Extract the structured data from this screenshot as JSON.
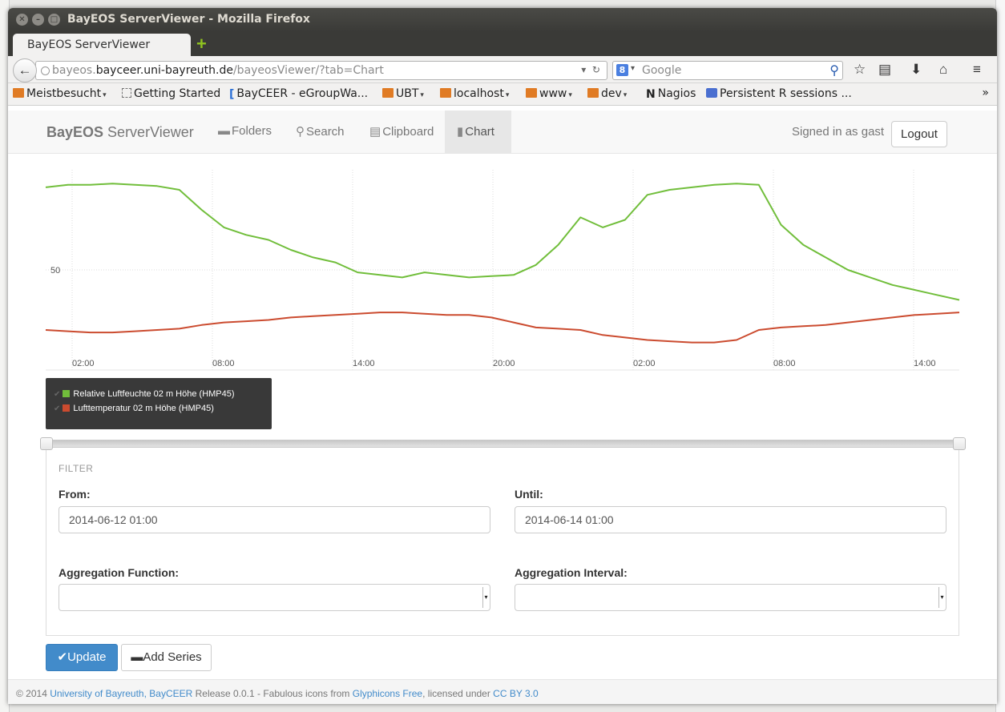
{
  "window": {
    "title": "BayEOS ServerViewer - Mozilla Firefox"
  },
  "browser": {
    "tab_title": "BayEOS ServerViewer",
    "url_prefix": "bayeos.",
    "url_domain": "bayceer.uni-bayreuth.de",
    "url_path": "/bayeosViewer/?tab=Chart",
    "search_placeholder": "Google",
    "bookmarks": [
      {
        "label": "Meistbesucht",
        "icon": "folder-icon",
        "caret": "▾"
      },
      {
        "label": "Getting Started",
        "icon": "blank-page-icon",
        "caret": ""
      },
      {
        "label": "BayCEER - eGroupWa...",
        "icon": "egroupware-icon",
        "caret": ""
      },
      {
        "label": "UBT",
        "icon": "folder-icon",
        "caret": "▾"
      },
      {
        "label": "localhost",
        "icon": "folder-icon",
        "caret": "▾"
      },
      {
        "label": "www",
        "icon": "folder-icon",
        "caret": "▾"
      },
      {
        "label": "dev",
        "icon": "folder-icon",
        "caret": "▾"
      },
      {
        "label": "Nagios",
        "icon": "nagios-icon",
        "caret": ""
      },
      {
        "label": "Persistent R sessions ...",
        "icon": "r-session-icon",
        "caret": ""
      }
    ]
  },
  "app": {
    "brand_bold": "BayEOS",
    "brand_rest": " ServerViewer",
    "nav": [
      {
        "label": "Folders",
        "icon": "folder-open-icon"
      },
      {
        "label": "Search",
        "icon": "search-icon"
      },
      {
        "label": "Clipboard",
        "icon": "list-icon"
      },
      {
        "label": "Chart",
        "icon": "bar-chart-icon"
      }
    ],
    "active_tab": "Chart",
    "signed_in_text": "Signed in as gast",
    "logout_label": "Logout"
  },
  "chart_data": {
    "type": "line",
    "x_tick_labels": [
      "02:00",
      "08:00",
      "14:00",
      "20:00",
      "02:00",
      "08:00",
      "14:00"
    ],
    "y_tick_labels": [
      "50"
    ],
    "grid": true,
    "legend_position": "bottom-left",
    "series": [
      {
        "name": "Relative Luftfeuchte 02 m Höhe (HMP45)",
        "color": "#71be3b",
        "values": [
          83,
          84,
          84,
          84.5,
          84,
          83.5,
          82,
          74,
          67,
          64,
          62,
          58,
          55,
          53,
          49,
          48,
          47,
          49,
          48,
          47,
          47.5,
          48,
          52,
          60,
          71,
          67,
          70,
          80,
          82,
          83,
          84,
          84.5,
          84,
          68,
          60,
          55,
          50,
          47,
          44,
          42,
          40,
          38
        ]
      },
      {
        "name": "Lufttemperatur 02 m Höhe (HMP45)",
        "color": "#cb4b2f",
        "values": [
          26,
          25.5,
          25,
          25,
          25.5,
          26,
          26.5,
          28,
          29,
          29.5,
          30,
          31,
          31.5,
          32,
          32.5,
          33,
          33,
          32.5,
          32,
          32,
          31,
          29,
          27,
          26.5,
          26,
          24,
          23,
          22,
          21.5,
          21,
          21,
          22,
          26,
          27,
          27.5,
          28,
          29,
          30,
          31,
          32,
          32.5,
          33
        ]
      }
    ]
  },
  "filter": {
    "title": "FILTER",
    "from_label": "From:",
    "from_value": "2014-06-12 01:00",
    "until_label": "Until:",
    "until_value": "2014-06-14 01:00",
    "agg_function_label": "Aggregation Function:",
    "agg_function_value": "",
    "agg_interval_label": "Aggregation Interval:",
    "agg_interval_value": ""
  },
  "actions": {
    "update_label": "Update",
    "add_series_label": "Add Series"
  },
  "footer": {
    "prefix": "© 2014 ",
    "link1": "University of Bayreuth, BayCEER",
    "mid": " Release 0.0.1 - Fabulous icons from ",
    "link2": "Glyphicons Free",
    "mid2": ", licensed under ",
    "link3": "CC BY 3.0"
  }
}
